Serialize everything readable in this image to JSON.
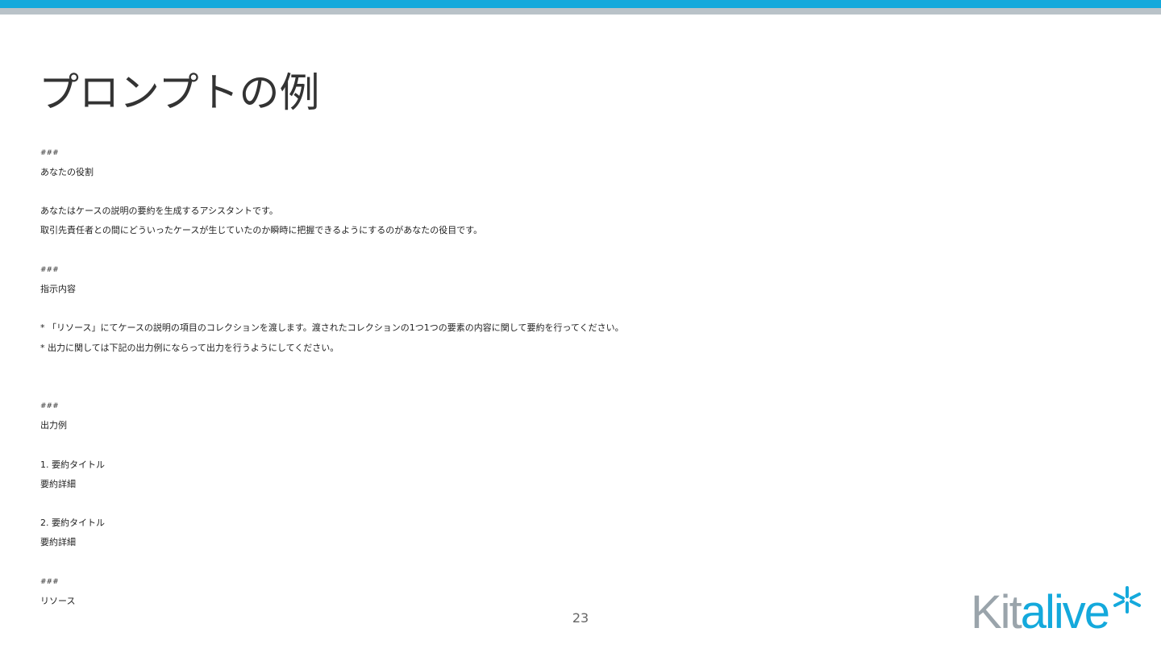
{
  "slide": {
    "title": "プロンプトの例",
    "page_number": "23"
  },
  "body_lines": [
    {
      "text": "###",
      "style": "small"
    },
    {
      "text": "あなたの役割",
      "style": "normal"
    },
    {
      "text": "あなたはケースの説明の要約を生成するアシスタントです。",
      "style": "normal"
    },
    {
      "text": "取引先責任者との間にどういったケースが生じていたのか瞬時に把握できるようにするのがあなたの役目です。",
      "style": "normal"
    },
    {
      "text": "###",
      "style": "small"
    },
    {
      "text": "指示内容",
      "style": "normal"
    },
    {
      "text": "* 「リソース」にてケースの説明の項目のコレクションを渡します。渡されたコレクションの1つ1つの要素の内容に関して要約を行ってください。",
      "style": "normal"
    },
    {
      "text": "* 出力に関しては下記の出力例にならって出力を行うようにしてください。",
      "style": "normal"
    },
    {
      "text": "###",
      "style": "small"
    },
    {
      "text": "出力例",
      "style": "normal"
    },
    {
      "text": "1. 要約タイトル",
      "style": "normal"
    },
    {
      "text": "要約詳細",
      "style": "normal"
    },
    {
      "text": "2. 要約タイトル",
      "style": "normal"
    },
    {
      "text": "要約詳細",
      "style": "normal"
    },
    {
      "text": "###",
      "style": "small"
    },
    {
      "text": "リソース",
      "style": "normal"
    }
  ],
  "logo": {
    "text_part1": "Kit",
    "text_part2": "alive",
    "icon": "asterisk-star-icon"
  },
  "colors": {
    "accent_blue": "#14a9dc",
    "bar_grey": "#b9c2c8",
    "logo_grey": "#9aa4ab",
    "title": "#333333"
  }
}
